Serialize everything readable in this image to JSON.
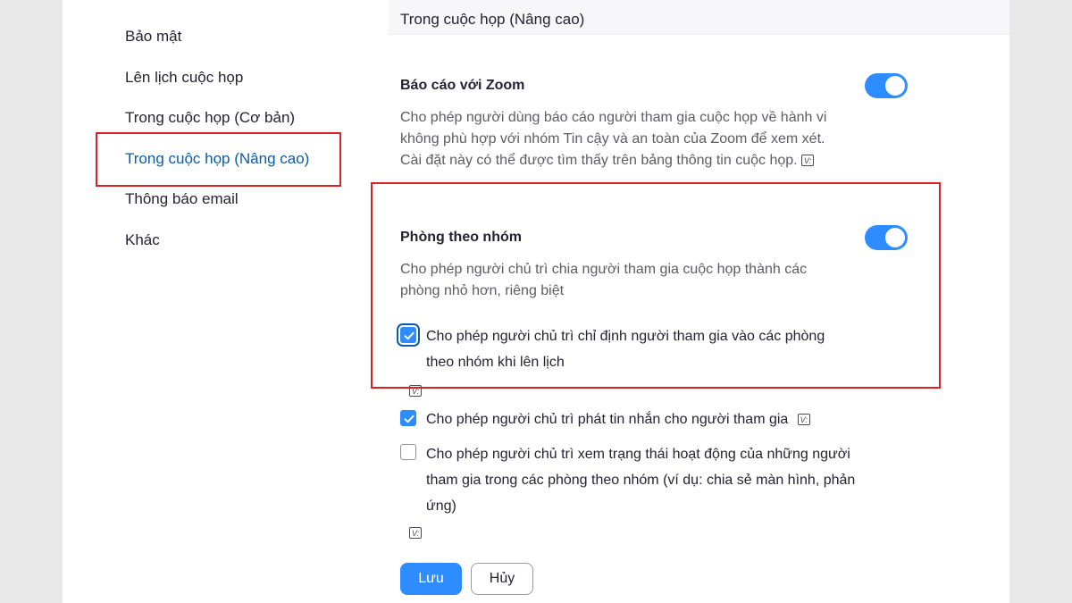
{
  "sidebar": {
    "items": [
      {
        "label": "Bảo mật"
      },
      {
        "label": "Lên lịch cuộc họp"
      },
      {
        "label": "Trong cuộc họp (Cơ bản)"
      },
      {
        "label": "Trong cuộc họp (Nâng cao)",
        "active": true
      },
      {
        "label": "Thông báo email"
      },
      {
        "label": "Khác"
      }
    ]
  },
  "section": {
    "title": "Trong cuộc họp (Nâng cao)"
  },
  "report": {
    "title": "Báo cáo với Zoom",
    "enabled": true,
    "desc_line1": "Cho phép người dùng báo cáo người tham gia cuộc họp về hành vi",
    "desc_line2": "không phù hợp với nhóm Tin cậy và an toàn của Zoom để xem xét.",
    "desc_line3": "Cài đặt này có thể được tìm thấy trên bảng thông tin cuộc họp."
  },
  "breakout": {
    "title": "Phòng theo nhóm",
    "enabled": true,
    "desc_line1": "Cho phép người chủ trì chia người tham gia cuộc họp thành các",
    "desc_line2": "phòng nhỏ hơn, riêng biệt",
    "options": [
      {
        "line1": "Cho phép người chủ trì chỉ định người tham gia vào các phòng",
        "line2": "theo nhóm khi lên lịch",
        "checked": true
      },
      {
        "line1": "Cho phép người chủ trì phát tin nhắn cho người tham gia",
        "checked": true
      },
      {
        "line1": "Cho phép người chủ trì xem trạng thái hoạt động của những người",
        "line2": "tham gia trong các phòng theo nhóm (ví dụ: chia sẻ màn hình, phản",
        "line3": "ứng)",
        "checked": false
      }
    ]
  },
  "badge": {
    "text": "V:"
  },
  "buttons": {
    "save": "Lưu",
    "cancel": "Hủy"
  },
  "colors": {
    "accent": "#2d8cff",
    "active_nav": "#0e5ba8",
    "highlight": "#d92027"
  }
}
